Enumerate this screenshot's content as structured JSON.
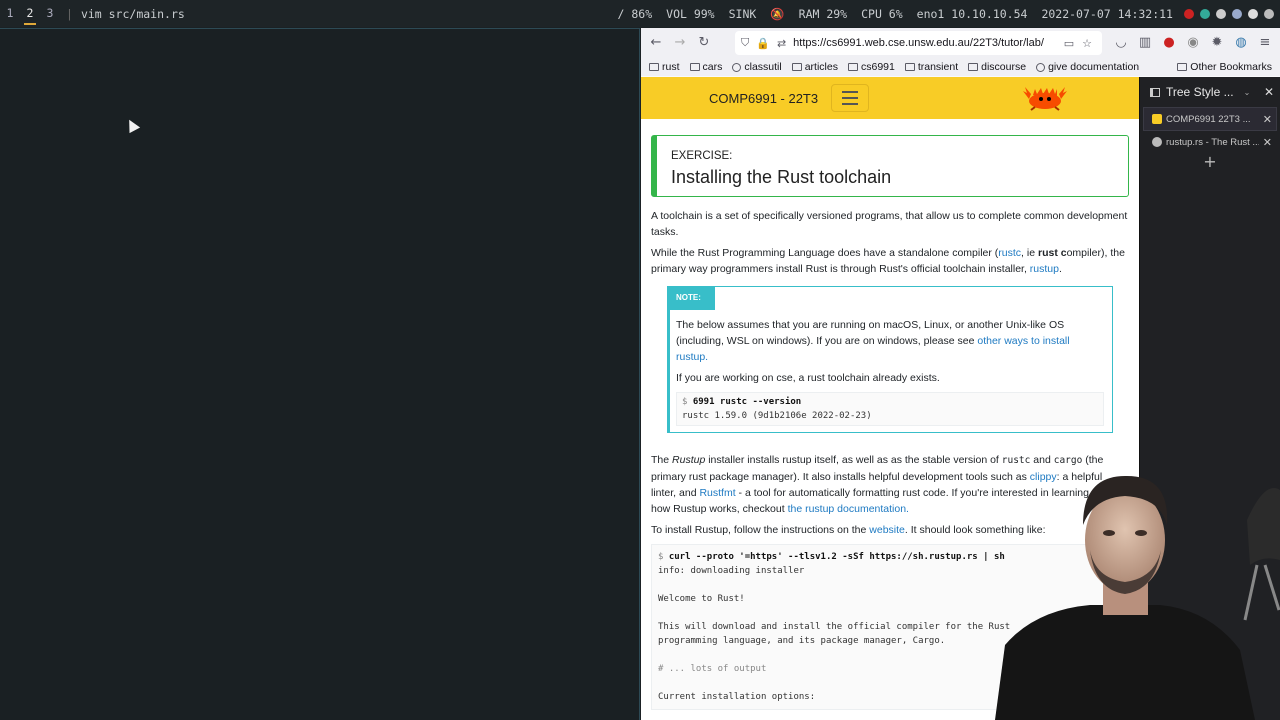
{
  "statusbar": {
    "workspaces": [
      "1",
      "2",
      "3"
    ],
    "active_workspace": "2",
    "window_title": "vim src/main.rs",
    "brightness": "/ 86%",
    "volume": "VOL 99%",
    "sink": "SINK ",
    "ram": "RAM 29%",
    "cpu": "CPU  6%",
    "network": "eno1 10.10.10.54",
    "datetime": "2022-07-07 14:32:11"
  },
  "browser": {
    "url": "https://cs6991.web.cse.unsw.edu.au/22T3/tutor/lab/",
    "bookmarks": [
      "rust",
      "cars",
      "classutil",
      "articles",
      "cs6991",
      "transient",
      "discourse",
      "give documentation"
    ],
    "other_bookmarks": "Other Bookmarks"
  },
  "page": {
    "course_title": "COMP6991 - 22T3",
    "exercise_kicker": "EXERCISE:",
    "exercise_title": "Installing the Rust toolchain",
    "para1": "A toolchain is a set of specifically versioned programs, that allow us to complete common development tasks.",
    "para2_a": "While the Rust Programming Language does have a standalone compiler (",
    "para2_link1": "rustc",
    "para2_b": ", ie ",
    "para2_bold": "rust c",
    "para2_c": "ompiler), the primary way programmers install Rust is through Rust's official toolchain installer, ",
    "para2_link2": "rustup",
    "para2_d": ".",
    "note_label": "NOTE:",
    "note_text": "The below assumes that you are running on macOS, Linux, or another Unix-like OS (including, WSL on windows). If you are on windows, please see ",
    "note_link": "other ways to install rustup.",
    "note_text2": "If you are working on cse, a rust toolchain already exists.",
    "note_prompt": "$",
    "note_cmd": "6991 rustc --version",
    "note_output": "rustc 1.59.0 (9d1b2106e 2022-02-23)",
    "para3_a": "The ",
    "para3_em": "Rustup",
    "para3_b": " installer installs rustup itself, as well as as the stable version of ",
    "para3_code1": "rustc",
    "para3_c": " and ",
    "para3_code2": "cargo",
    "para3_d": " (the primary rust package manager). It also installs helpful development tools such as ",
    "para3_link1": "clippy",
    "para3_e": ": a helpful linter, and ",
    "para3_link2": "Rustfmt",
    "para3_f": " - a tool for automatically formatting rust code. If you're interested in learning about how Rustup works, checkout ",
    "para3_link3": "the rustup documentation.",
    "para4_a": "To install Rustup, follow the instructions on the ",
    "para4_link": "website",
    "para4_b": ". It should look something like:",
    "code_prompt": "$",
    "code_lines": [
      "curl --proto '=https' --tlsv1.2 -sSf https://sh.rustup.rs | sh",
      "info: downloading installer",
      "",
      "Welcome to Rust!",
      "",
      "This will download and install the official compiler for the Rust",
      "programming language, and its package manager, Cargo.",
      "",
      "# ... lots of output",
      "",
      "Current installation options:"
    ]
  },
  "sidebar": {
    "title": "Tree Style ...",
    "tabs": [
      {
        "label": "COMP6991 22T3 ..."
      },
      {
        "label": "rustup.rs - The Rust ..."
      }
    ]
  }
}
